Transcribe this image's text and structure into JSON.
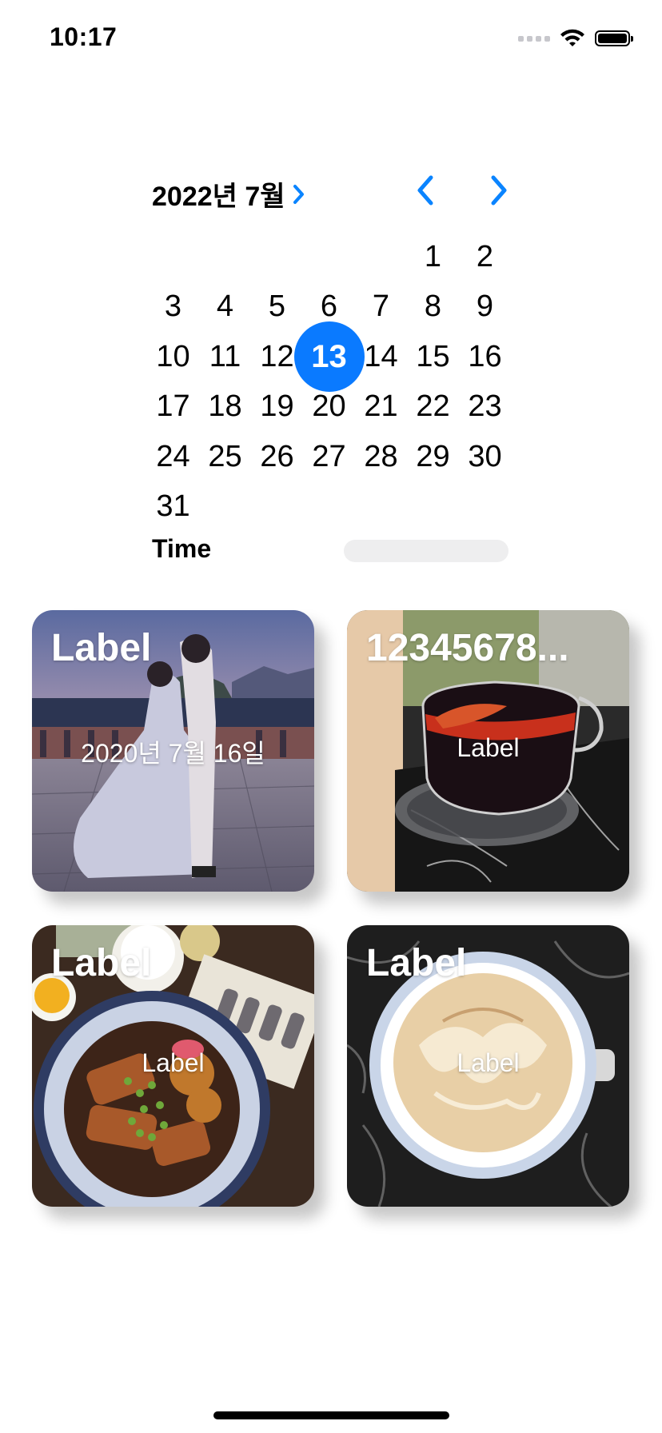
{
  "status_bar": {
    "time": "10:17",
    "icons": [
      "signal-icon",
      "wifi-icon",
      "battery-icon"
    ]
  },
  "calendar": {
    "month_label": "2022년 7월",
    "disclosure_icon": "chevron-right-icon",
    "prev_icon": "chevron-left-icon",
    "next_icon": "chevron-right-icon",
    "leading_blank_days": 5,
    "days": [
      "1",
      "2",
      "3",
      "4",
      "5",
      "6",
      "7",
      "8",
      "9",
      "10",
      "11",
      "12",
      "13",
      "14",
      "15",
      "16",
      "17",
      "18",
      "19",
      "20",
      "21",
      "22",
      "23",
      "24",
      "25",
      "26",
      "27",
      "28",
      "29",
      "30",
      "31"
    ],
    "selected_day": "13",
    "accent_color": "#0a7aff"
  },
  "time_row": {
    "label": "Time",
    "value": ""
  },
  "cards": [
    {
      "title": "Label",
      "subtitle": "2020년 7월 16일",
      "image": "couple-hanbok-photo"
    },
    {
      "title": "12345678...",
      "subtitle": "Label",
      "image": "mulled-wine-glass-photo"
    },
    {
      "title": "Label",
      "subtitle": "Label",
      "image": "braised-pork-dish-photo"
    },
    {
      "title": "Label",
      "subtitle": "Label",
      "image": "latte-cup-photo"
    }
  ]
}
